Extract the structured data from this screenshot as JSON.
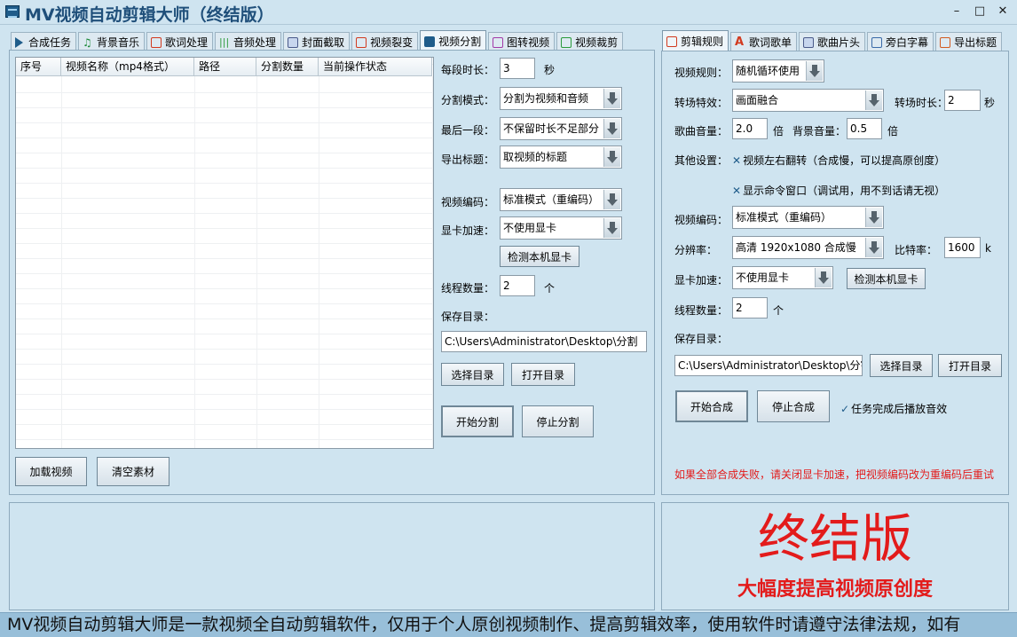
{
  "window": {
    "title": "MV视频自动剪辑大师（终结版）",
    "minimize": "–",
    "maximize": "□",
    "close": "✕"
  },
  "left_tabs": [
    {
      "label": "合成任务",
      "icon": "play-icon"
    },
    {
      "label": "背景音乐",
      "icon": "music-note-icon"
    },
    {
      "label": "歌词处理",
      "icon": "lyrics-icon"
    },
    {
      "label": "音频处理",
      "icon": "audio-wave-icon"
    },
    {
      "label": "封面截取",
      "icon": "image-icon"
    },
    {
      "label": "视频裂变",
      "icon": "copy-icon"
    },
    {
      "label": "视频分割",
      "icon": "video-icon"
    },
    {
      "label": "图转视频",
      "icon": "slideshow-icon"
    },
    {
      "label": "视频裁剪",
      "icon": "crop-icon"
    }
  ],
  "video_list": {
    "columns": [
      "序号",
      "视频名称（mp4格式）",
      "路径",
      "分割数量",
      "当前操作状态"
    ],
    "rows": []
  },
  "split": {
    "segment_length_label": "每段时长：",
    "segment_length_value": "3",
    "segment_length_unit": "秒",
    "split_mode_label": "分割模式：",
    "split_mode_value": "分割为视频和音频",
    "last_segment_label": "最后一段：",
    "last_segment_value": "不保留时长不足部分",
    "export_title_label": "导出标题：",
    "export_title_value": "取视频的标题",
    "video_codec_label": "视频编码：",
    "video_codec_value": "标准模式（重编码）",
    "gpu_label": "显卡加速：",
    "gpu_value": "不使用显卡",
    "detect_gpu_button": "检测本机显卡",
    "threads_label": "线程数量：",
    "threads_value": "2",
    "threads_unit": "个",
    "save_dir_label": "保存目录：",
    "save_dir_value": "C:\\Users\\Administrator\\Desktop\\分割",
    "choose_dir_button": "选择目录",
    "open_dir_button": "打开目录",
    "start_button": "开始分割",
    "stop_button": "停止分割"
  },
  "left_bottom": {
    "load_button": "加载视频",
    "clear_button": "清空素材"
  },
  "right_tabs": [
    {
      "label": "剪辑规则",
      "icon": "film-icon"
    },
    {
      "label": "歌词歌单",
      "icon": "font-icon"
    },
    {
      "label": "歌曲片头",
      "icon": "image-icon"
    },
    {
      "label": "旁白字幕",
      "icon": "document-icon"
    },
    {
      "label": "导出标题",
      "icon": "export-icon"
    }
  ],
  "rules": {
    "video_rule_label": "视频规则：",
    "video_rule_value": "随机循环使用",
    "transition_label": "转场特效：",
    "transition_value": "画面融合",
    "transition_duration_label": "转场时长：",
    "transition_duration_value": "2",
    "transition_duration_unit": "秒",
    "song_volume_label": "歌曲音量：",
    "song_volume_value": "2.0",
    "song_volume_unit": "倍",
    "bg_volume_label": "背景音量：",
    "bg_volume_value": "0.5",
    "bg_volume_unit": "倍",
    "other_label": "其他设置：",
    "flip_option": "视频左右翻转（合成慢，可以提高原创度）",
    "console_option": "显示命令窗口（调试用，用不到话请无视）",
    "video_codec_label": "视频编码：",
    "video_codec_value": "标准模式（重编码）",
    "resolution_label": "分辨率：",
    "resolution_value": "高清 1920x1080 合成慢",
    "bitrate_label": "比特率：",
    "bitrate_value": "1600",
    "bitrate_unit": "k",
    "gpu_label": "显卡加速：",
    "gpu_value": "不使用显卡",
    "detect_gpu_button": "检测本机显卡",
    "threads_label": "线程数量：",
    "threads_value": "2",
    "threads_unit": "个",
    "save_dir_label": "保存目录：",
    "save_dir_value": "C:\\Users\\Administrator\\Desktop\\分割",
    "choose_dir_button": "选择目录",
    "open_dir_button": "打开目录",
    "start_button": "开始合成",
    "stop_button": "停止合成",
    "play_sound_option": "任务完成后播放音效",
    "warning": "如果全部合成失败，请关闭显卡加速，把视频编码改为重编码后重试"
  },
  "banner": {
    "title": "终结版",
    "subtitle": "大幅度提高视频原创度"
  },
  "status_text": "MV视频自动剪辑大师是一款视频全自动剪辑软件，仅用于个人原创视频制作、提高剪辑效率，使用软件时请遵守法律法规，如有",
  "colors": {
    "accent": "#1f5c8a",
    "warning": "#e31b1b",
    "background": "#cfe4f0",
    "statusbar": "#98bfd9"
  }
}
